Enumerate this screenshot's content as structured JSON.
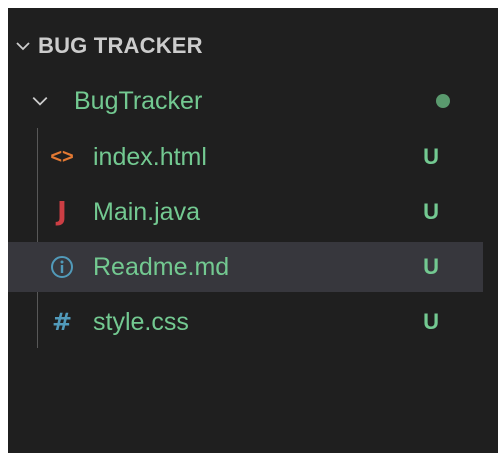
{
  "section": {
    "title": "BUG TRACKER",
    "chevron_icon": "chevron-down-icon"
  },
  "folder": {
    "name": "BugTracker",
    "chevron_icon": "chevron-down-icon",
    "status_dot_color": "#5a9a6e"
  },
  "files": [
    {
      "name": "index.html",
      "icon": "html-code-icon",
      "icon_glyph": "<>",
      "icon_color": "#e37933",
      "status": "U"
    },
    {
      "name": "Main.java",
      "icon": "java-icon",
      "icon_glyph": "J",
      "icon_color": "#cc3e44",
      "status": "U"
    },
    {
      "name": "Readme.md",
      "icon": "info-icon",
      "icon_color": "#519aba",
      "status": "U",
      "selected": true
    },
    {
      "name": "style.css",
      "icon": "hash-icon",
      "icon_glyph": "#",
      "icon_color": "#519aba",
      "status": "U"
    }
  ],
  "colors": {
    "background": "#1f1f1f",
    "selected_row": "#37373d",
    "untracked_text": "#73c991",
    "header_text": "#cccccc"
  }
}
